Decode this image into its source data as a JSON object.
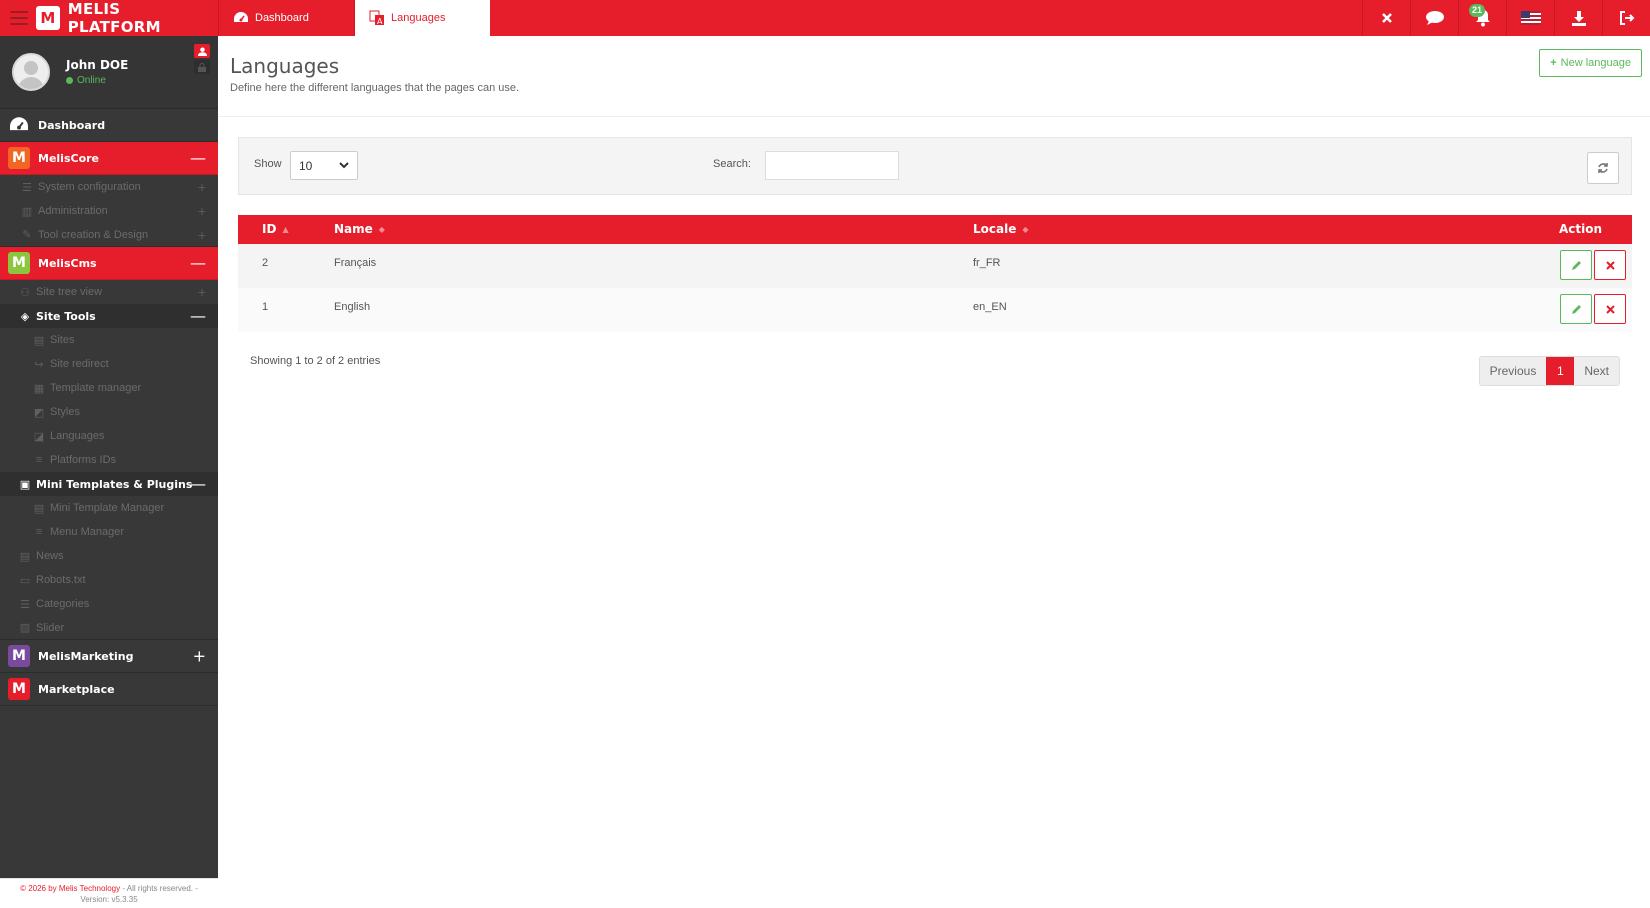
{
  "brand": {
    "title": "MELIS PLATFORM",
    "logo_letter": "M"
  },
  "tabs": [
    {
      "label": "Dashboard",
      "icon": "dashboard-icon"
    },
    {
      "label": "Languages",
      "icon": "language-icon"
    }
  ],
  "topbar": {
    "notification_count": "21",
    "icons": [
      "close-icon",
      "chat-icon",
      "bell-icon",
      "us-flag-icon",
      "download-icon",
      "logout-icon"
    ]
  },
  "user": {
    "name": "John DOE",
    "status": "Online"
  },
  "sidebar": {
    "dashboard": "Dashboard",
    "core": {
      "label": "MelisCore",
      "items": [
        "System configuration",
        "Administration",
        "Tool creation & Design"
      ]
    },
    "cms": {
      "label": "MelisCms",
      "site_tree": "Site tree view",
      "site_tools": {
        "label": "Site Tools",
        "items": [
          "Sites",
          "Site redirect",
          "Template manager",
          "Styles",
          "Languages",
          "Platforms IDs"
        ]
      },
      "mini_templates": {
        "label": "Mini Templates & Plugins",
        "items": [
          "Mini Template Manager",
          "Menu Manager"
        ]
      },
      "extra_items": [
        "News",
        "Robots.txt",
        "Categories",
        "Slider"
      ]
    },
    "marketing": "MelisMarketing",
    "marketplace": "Marketplace",
    "footer": {
      "copyright": "© 2026 by Melis Technology",
      "rights": " - All rights reserved. -",
      "version": "Version: v5.3.35"
    }
  },
  "page": {
    "title": "Languages",
    "subtitle": "Define here the different languages that the pages can use.",
    "new_button": "New language"
  },
  "toolbar": {
    "show_label": "Show",
    "show_value": "10",
    "search_label": "Search:",
    "search_value": ""
  },
  "table": {
    "columns": [
      "ID",
      "Name",
      "Locale",
      "Action"
    ],
    "rows": [
      {
        "id": "2",
        "name": "Français",
        "locale": "fr_FR"
      },
      {
        "id": "1",
        "name": "English",
        "locale": "en_EN"
      }
    ]
  },
  "footer_info": {
    "showing": "Showing 1 to 2 of 2 entries"
  },
  "pagination": {
    "previous": "Previous",
    "current": "1",
    "next": "Next"
  },
  "colors": {
    "accent": "#e61e2b",
    "sidebar": "#383838",
    "success": "#5cb85c",
    "core_logo": "#f26522",
    "cms_logo": "#8cc63f",
    "marketing_logo": "#7a4a9c"
  }
}
